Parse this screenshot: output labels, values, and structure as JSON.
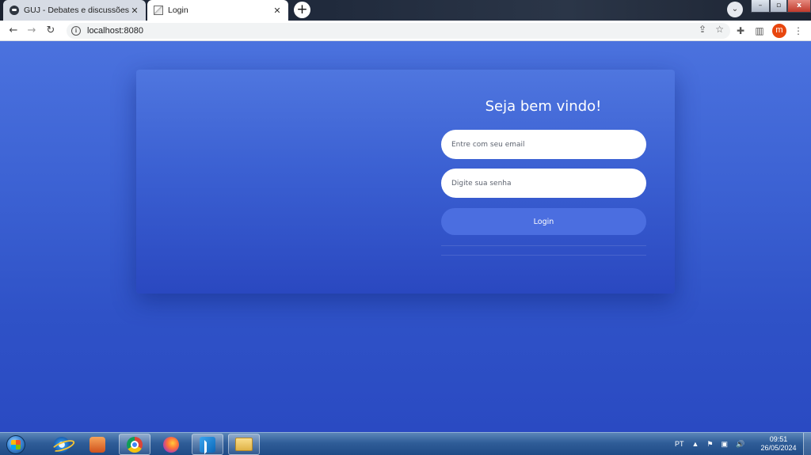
{
  "browser": {
    "tabs": [
      {
        "title": "GUJ - Debates e discussões sobre",
        "favicon": "guj-logo-icon",
        "active": false
      },
      {
        "title": "Login",
        "favicon": "image-icon",
        "active": true
      }
    ],
    "close_glyph": "✕",
    "newtab_glyph": "+",
    "url": "localhost:8080",
    "profile_initial": "m"
  },
  "login": {
    "heading": "Seja bem vindo!",
    "email_placeholder": "Entre com seu email",
    "password_placeholder": "Digite sua senha",
    "submit_label": "Login"
  },
  "taskbar": {
    "apps": [
      "start-icon",
      "internet-explorer-icon",
      "media-player-icon",
      "chrome-icon",
      "firefox-icon",
      "vscode-icon",
      "file-explorer-icon"
    ],
    "language": "PT",
    "time": "09:51",
    "date": "26/05/2024"
  },
  "colors": {
    "page_bg_top": "#4b72de",
    "page_bg_bottom": "#2a4ac2",
    "button_bg": "#4b6ee0",
    "input_bg": "#ffffff"
  }
}
